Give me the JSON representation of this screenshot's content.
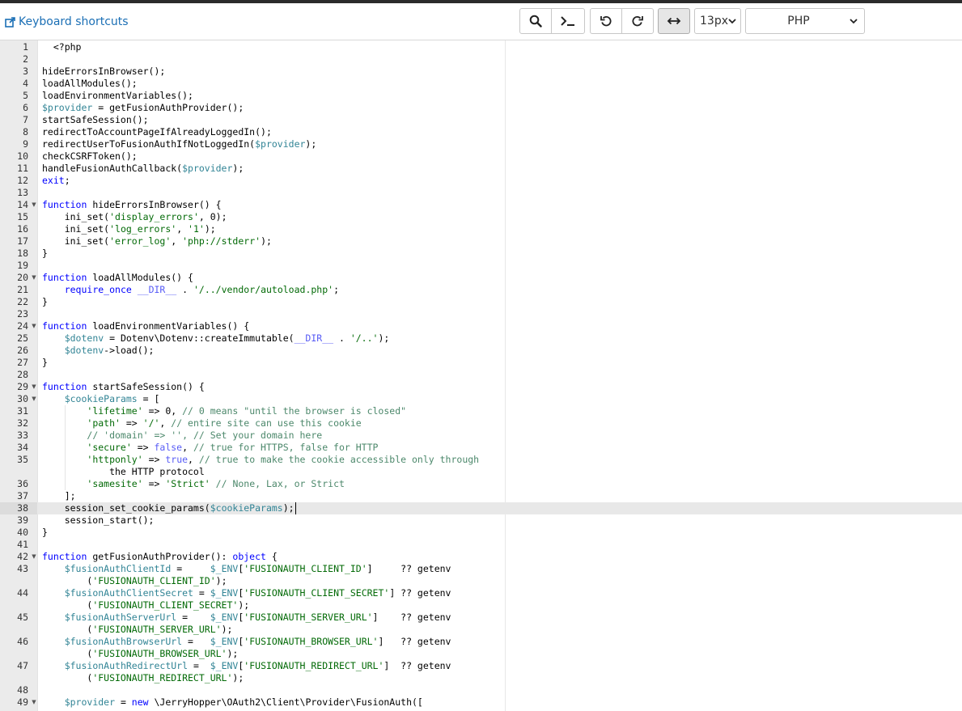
{
  "toolbar": {
    "shortcuts_label": "Keyboard shortcuts",
    "font_size": "13px",
    "language": "PHP",
    "buttons": [
      "search-icon",
      "terminal-icon",
      "undo-icon",
      "redo-icon",
      "wrap-icon"
    ]
  },
  "editor": {
    "active_line": 38,
    "lines": [
      {
        "n": "1",
        "t": "  <?php"
      },
      {
        "n": "2",
        "t": ""
      },
      {
        "n": "3",
        "t": "hideErrorsInBrowser();"
      },
      {
        "n": "4",
        "t": "loadAllModules();"
      },
      {
        "n": "5",
        "t": "loadEnvironmentVariables();"
      },
      {
        "n": "6",
        "t": "$provider = getFusionAuthProvider();"
      },
      {
        "n": "7",
        "t": "startSafeSession();"
      },
      {
        "n": "8",
        "t": "redirectToAccountPageIfAlreadyLoggedIn();"
      },
      {
        "n": "9",
        "t": "redirectUserToFusionAuthIfNotLoggedIn($provider);"
      },
      {
        "n": "10",
        "t": "checkCSRFToken();"
      },
      {
        "n": "11",
        "t": "handleFusionAuthCallback($provider);"
      },
      {
        "n": "12",
        "t": "exit;"
      },
      {
        "n": "13",
        "t": ""
      },
      {
        "n": "14",
        "t": "function hideErrorsInBrowser() {",
        "fold": true
      },
      {
        "n": "15",
        "t": "    ini_set('display_errors', 0);"
      },
      {
        "n": "16",
        "t": "    ini_set('log_errors', '1');"
      },
      {
        "n": "17",
        "t": "    ini_set('error_log', 'php://stderr');"
      },
      {
        "n": "18",
        "t": "}"
      },
      {
        "n": "19",
        "t": ""
      },
      {
        "n": "20",
        "t": "function loadAllModules() {",
        "fold": true
      },
      {
        "n": "21",
        "t": "    require_once __DIR__ . '/../vendor/autoload.php';"
      },
      {
        "n": "22",
        "t": "}"
      },
      {
        "n": "23",
        "t": ""
      },
      {
        "n": "24",
        "t": "function loadEnvironmentVariables() {",
        "fold": true
      },
      {
        "n": "25",
        "t": "    $dotenv = Dotenv\\Dotenv::createImmutable(__DIR__ . '/..');"
      },
      {
        "n": "26",
        "t": "    $dotenv->load();"
      },
      {
        "n": "27",
        "t": "}"
      },
      {
        "n": "28",
        "t": ""
      },
      {
        "n": "29",
        "t": "function startSafeSession() {",
        "fold": true
      },
      {
        "n": "30",
        "t": "    $cookieParams = [",
        "fold": true
      },
      {
        "n": "31",
        "t": "        'lifetime' => 0, // 0 means \"until the browser is closed\""
      },
      {
        "n": "32",
        "t": "        'path' => '/', // entire site can use this cookie"
      },
      {
        "n": "33",
        "t": "        // 'domain' => '', // Set your domain here"
      },
      {
        "n": "34",
        "t": "        'secure' => false, // true for HTTPS, false for HTTP"
      },
      {
        "n": "35",
        "t": "        'httponly' => true, // true to make the cookie accessible only through",
        "wrap": "            the HTTP protocol"
      },
      {
        "n": "36",
        "t": "        'samesite' => 'Strict' // None, Lax, or Strict"
      },
      {
        "n": "37",
        "t": "    ];"
      },
      {
        "n": "38",
        "t": "    session_set_cookie_params($cookieParams);"
      },
      {
        "n": "39",
        "t": "    session_start();"
      },
      {
        "n": "40",
        "t": "}"
      },
      {
        "n": "41",
        "t": ""
      },
      {
        "n": "42",
        "t": "function getFusionAuthProvider(): object {",
        "fold": true
      },
      {
        "n": "43",
        "t": "    $fusionAuthClientId =     $_ENV['FUSIONAUTH_CLIENT_ID']     ?? getenv",
        "wrap": "        ('FUSIONAUTH_CLIENT_ID');"
      },
      {
        "n": "44",
        "t": "    $fusionAuthClientSecret = $_ENV['FUSIONAUTH_CLIENT_SECRET'] ?? getenv",
        "wrap": "        ('FUSIONAUTH_CLIENT_SECRET');"
      },
      {
        "n": "45",
        "t": "    $fusionAuthServerUrl =    $_ENV['FUSIONAUTH_SERVER_URL']    ?? getenv",
        "wrap": "        ('FUSIONAUTH_SERVER_URL');"
      },
      {
        "n": "46",
        "t": "    $fusionAuthBrowserUrl =   $_ENV['FUSIONAUTH_BROWSER_URL']   ?? getenv",
        "wrap": "        ('FUSIONAUTH_BROWSER_URL');"
      },
      {
        "n": "47",
        "t": "    $fusionAuthRedirectUrl =  $_ENV['FUSIONAUTH_REDIRECT_URL']  ?? getenv",
        "wrap": "        ('FUSIONAUTH_REDIRECT_URL');"
      },
      {
        "n": "48",
        "t": ""
      },
      {
        "n": "49",
        "t": "    $provider = new \\JerryHopper\\OAuth2\\Client\\Provider\\FusionAuth([",
        "fold": true
      }
    ]
  },
  "colors": {
    "link": "#1b6fb5",
    "keyword": "#0000ff",
    "variable": "#318495",
    "string": "#036a07",
    "comment": "#4c886b",
    "constant": "#585cf6",
    "gutter": "#ebebeb",
    "active_line": "#e8e8e8"
  }
}
